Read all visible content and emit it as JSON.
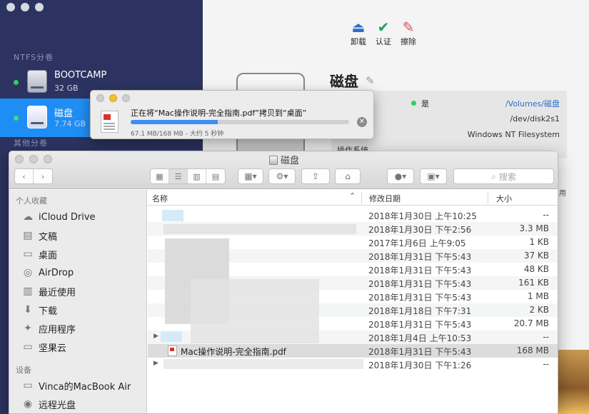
{
  "ntfs_app": {
    "sections": {
      "ntfs": "NTFS分卷",
      "other": "其他分卷"
    },
    "volumes": [
      {
        "name": "BOOTCAMP",
        "size": "32 GB"
      },
      {
        "name": "磁盘",
        "size": "7.74 GB"
      }
    ],
    "toolbar": {
      "unmount": "卸载",
      "verify": "认证",
      "erase": "擦除"
    },
    "detail": {
      "title": "磁盘",
      "mounted": "是",
      "mount_path": "/Volumes/磁盘",
      "device": "/dev/disk2s1",
      "filesystem": "Windows NT Filesystem",
      "os_label": "操作系统",
      "edge_label": "用"
    }
  },
  "copy_dialog": {
    "message": "正在将“Mac操作说明-完全指南.pdf”拷贝到“桌面”",
    "status": "67.1 MB/168 MB - 大约 5 秒钟",
    "progress_percent": 40
  },
  "finder": {
    "title": "磁盘",
    "search_placeholder": "搜索",
    "sidebar": {
      "favorites_header": "个人收藏",
      "favorites": [
        "iCloud Drive",
        "文稿",
        "桌面",
        "AirDrop",
        "最近使用",
        "下载",
        "应用程序",
        "坚果云"
      ],
      "devices_header": "设备",
      "devices": [
        "Vinca的MacBook Air",
        "远程光盘"
      ]
    },
    "columns": {
      "name": "名称",
      "date": "修改日期",
      "size": "大小"
    },
    "rows": [
      {
        "date": "2018年1月30日 上午10:25",
        "size": "--"
      },
      {
        "date": "2018年1月30日 下午2:56",
        "size": "3.3 MB"
      },
      {
        "date": "2017年1月6日 上午9:05",
        "size": "1 KB"
      },
      {
        "date": "2018年1月31日 下午5:43",
        "size": "37 KB"
      },
      {
        "date": "2018年1月31日 下午5:43",
        "size": "48 KB"
      },
      {
        "date": "2018年1月31日 下午5:43",
        "size": "161 KB"
      },
      {
        "date": "2018年1月31日 下午5:43",
        "size": "1 MB"
      },
      {
        "date": "2018年1月18日 下午7:31",
        "size": "2 KB"
      },
      {
        "date": "2018年1月31日 下午5:43",
        "size": "20.7 MB"
      },
      {
        "date": "2018年1月4日 上午10:53",
        "size": "--"
      },
      {
        "name": "Mac操作说明-完全指南.pdf",
        "date": "2018年1月31日 下午5:43",
        "size": "168 MB"
      },
      {
        "date": "2018年1月30日 下午1:26",
        "size": "--"
      }
    ]
  }
}
